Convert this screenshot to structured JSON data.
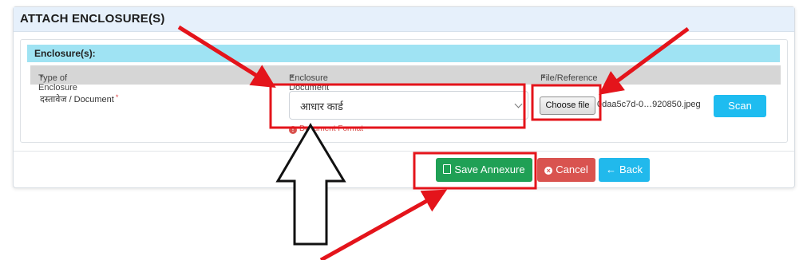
{
  "panel": {
    "title": "ATTACH ENCLOSURE(S)"
  },
  "enclosures": {
    "title": "Enclosure(s):",
    "columns": [
      {
        "label": "Type of Enclosure",
        "required_mark": "*"
      },
      {
        "label": "Enclosure Document",
        "required_mark": "*"
      },
      {
        "label": "File/Reference",
        "required_mark": "*"
      }
    ],
    "row": {
      "type_label": "दस्तावेज / Document",
      "required_mark": "*",
      "selected_document": "आधार कार्ड",
      "error_text": "Document Format",
      "choose_file_label": "Choose file",
      "file_name": "0daa5c7d-0…920850.jpeg",
      "scan_label": "Scan"
    }
  },
  "actions": {
    "save_label": "Save Annexure",
    "cancel_label": "Cancel",
    "back_label": "Back"
  },
  "colors": {
    "header_bg": "#e6f0fb",
    "section_header_bg": "#9fe3f3",
    "save": "#1fa055",
    "cancel": "#d9534f",
    "info": "#21b9ec",
    "annotation_red": "#e4141b"
  }
}
